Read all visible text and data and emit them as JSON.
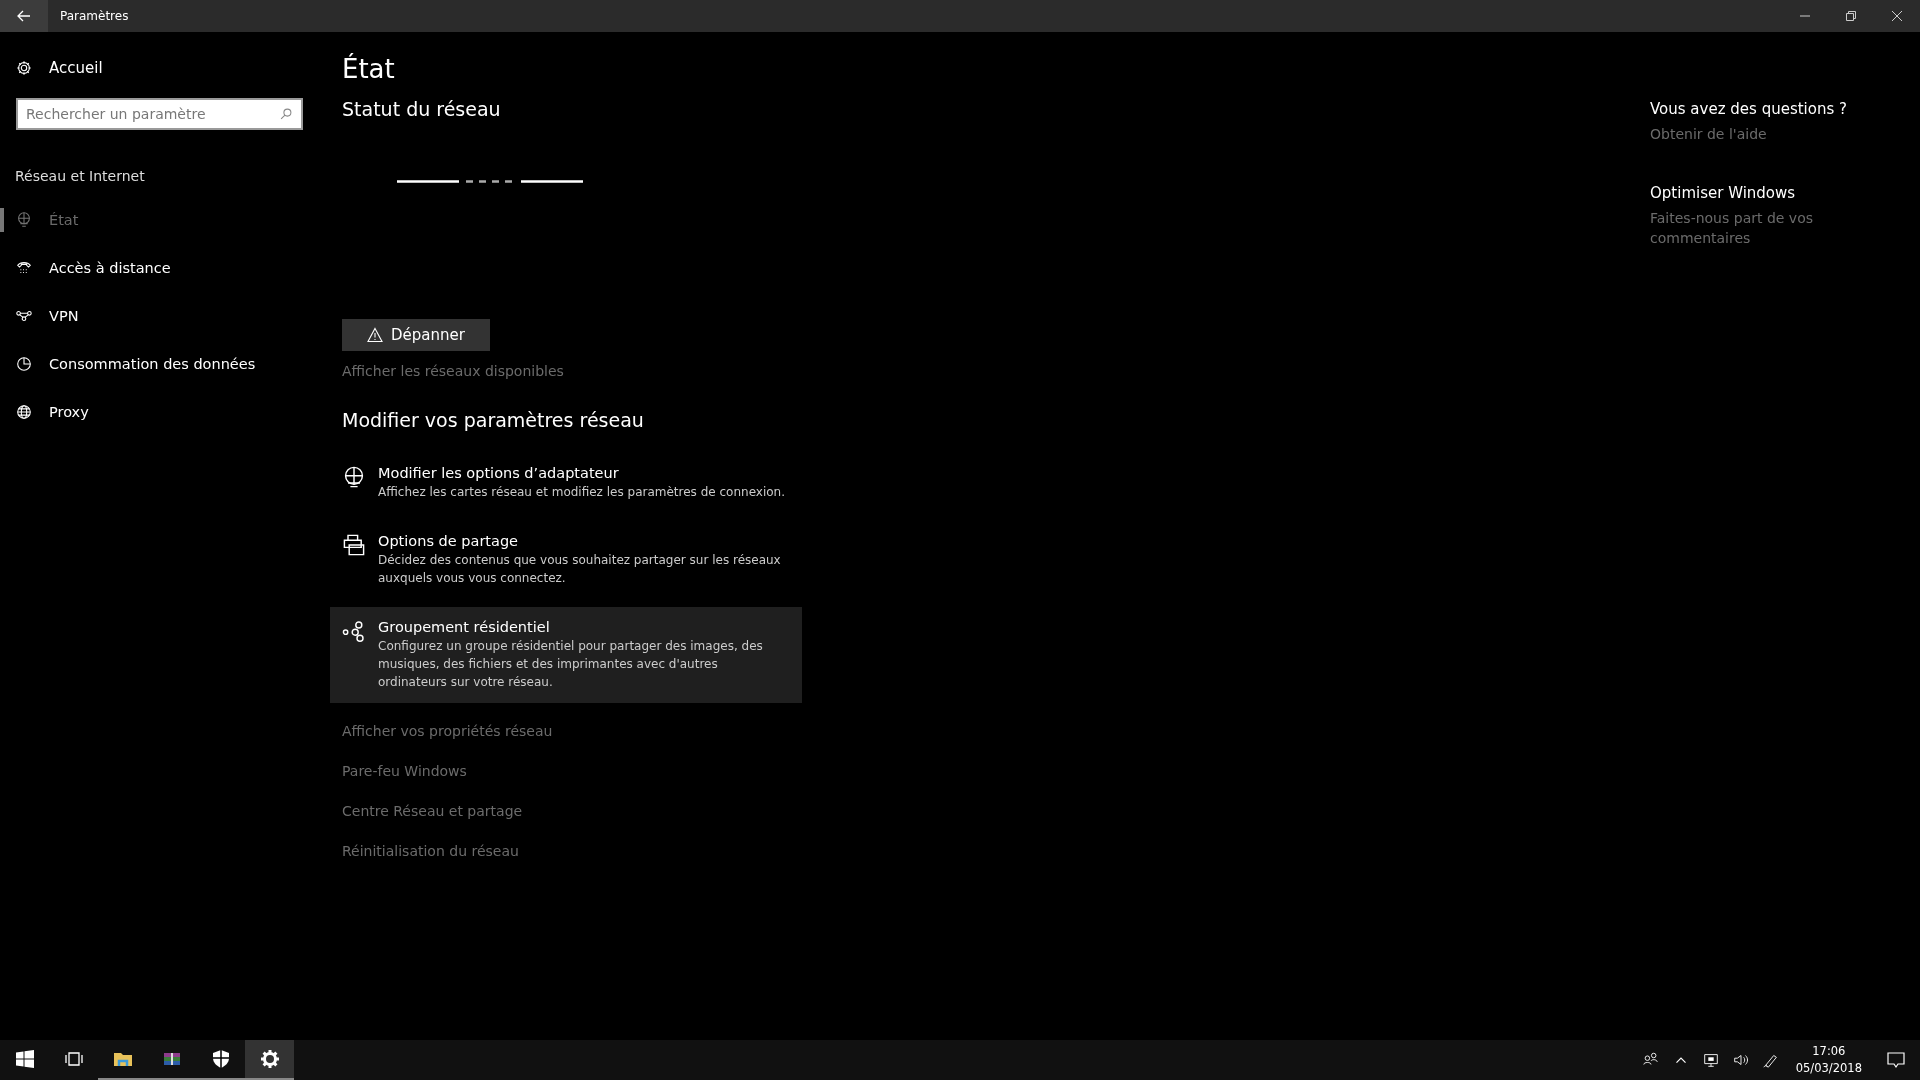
{
  "window": {
    "title": "Paramètres"
  },
  "sidebar": {
    "home": "Accueil",
    "search": {
      "placeholder": "Rechercher un paramètre"
    },
    "section": "Réseau et Internet",
    "items": [
      {
        "label": "État",
        "selected": true
      },
      {
        "label": "Accès à distance",
        "selected": false
      },
      {
        "label": "VPN",
        "selected": false
      },
      {
        "label": "Consommation des données",
        "selected": false
      },
      {
        "label": "Proxy",
        "selected": false
      }
    ]
  },
  "main": {
    "title": "État",
    "status_heading": "Statut du réseau",
    "troubleshoot_button": "Dépanner",
    "show_networks_link": "Afficher les réseaux disponibles",
    "change_heading": "Modifier vos paramètres réseau",
    "options": [
      {
        "title": "Modifier les options d’adaptateur",
        "description": "Affichez les cartes réseau et modifiez les paramètres de connexion.",
        "hovered": false
      },
      {
        "title": "Options de partage",
        "description": "Décidez des contenus que vous souhaitez partager sur les réseaux auxquels vous vous connectez.",
        "hovered": false
      },
      {
        "title": "Groupement résidentiel",
        "description": "Configurez un groupe résidentiel pour partager des images, des musiques, des fichiers et des imprimantes avec d'autres ordinateurs sur votre réseau.",
        "hovered": true
      }
    ],
    "links": [
      "Afficher vos propriétés réseau",
      "Pare-feu Windows",
      "Centre Réseau et partage",
      "Réinitialisation du réseau"
    ]
  },
  "aside": [
    {
      "heading": "Vous avez des questions ?",
      "link": "Obtenir de l'aide"
    },
    {
      "heading": "Optimiser Windows",
      "link": "Faites-nous part de vos commentaires"
    }
  ],
  "taskbar": {
    "apps": [
      {
        "running": false,
        "active": false
      },
      {
        "running": true,
        "active": false
      },
      {
        "running": true,
        "active": false
      },
      {
        "running": true,
        "active": false
      },
      {
        "running": true,
        "active": true
      }
    ],
    "time": "17:06",
    "date": "05/03/2018"
  }
}
